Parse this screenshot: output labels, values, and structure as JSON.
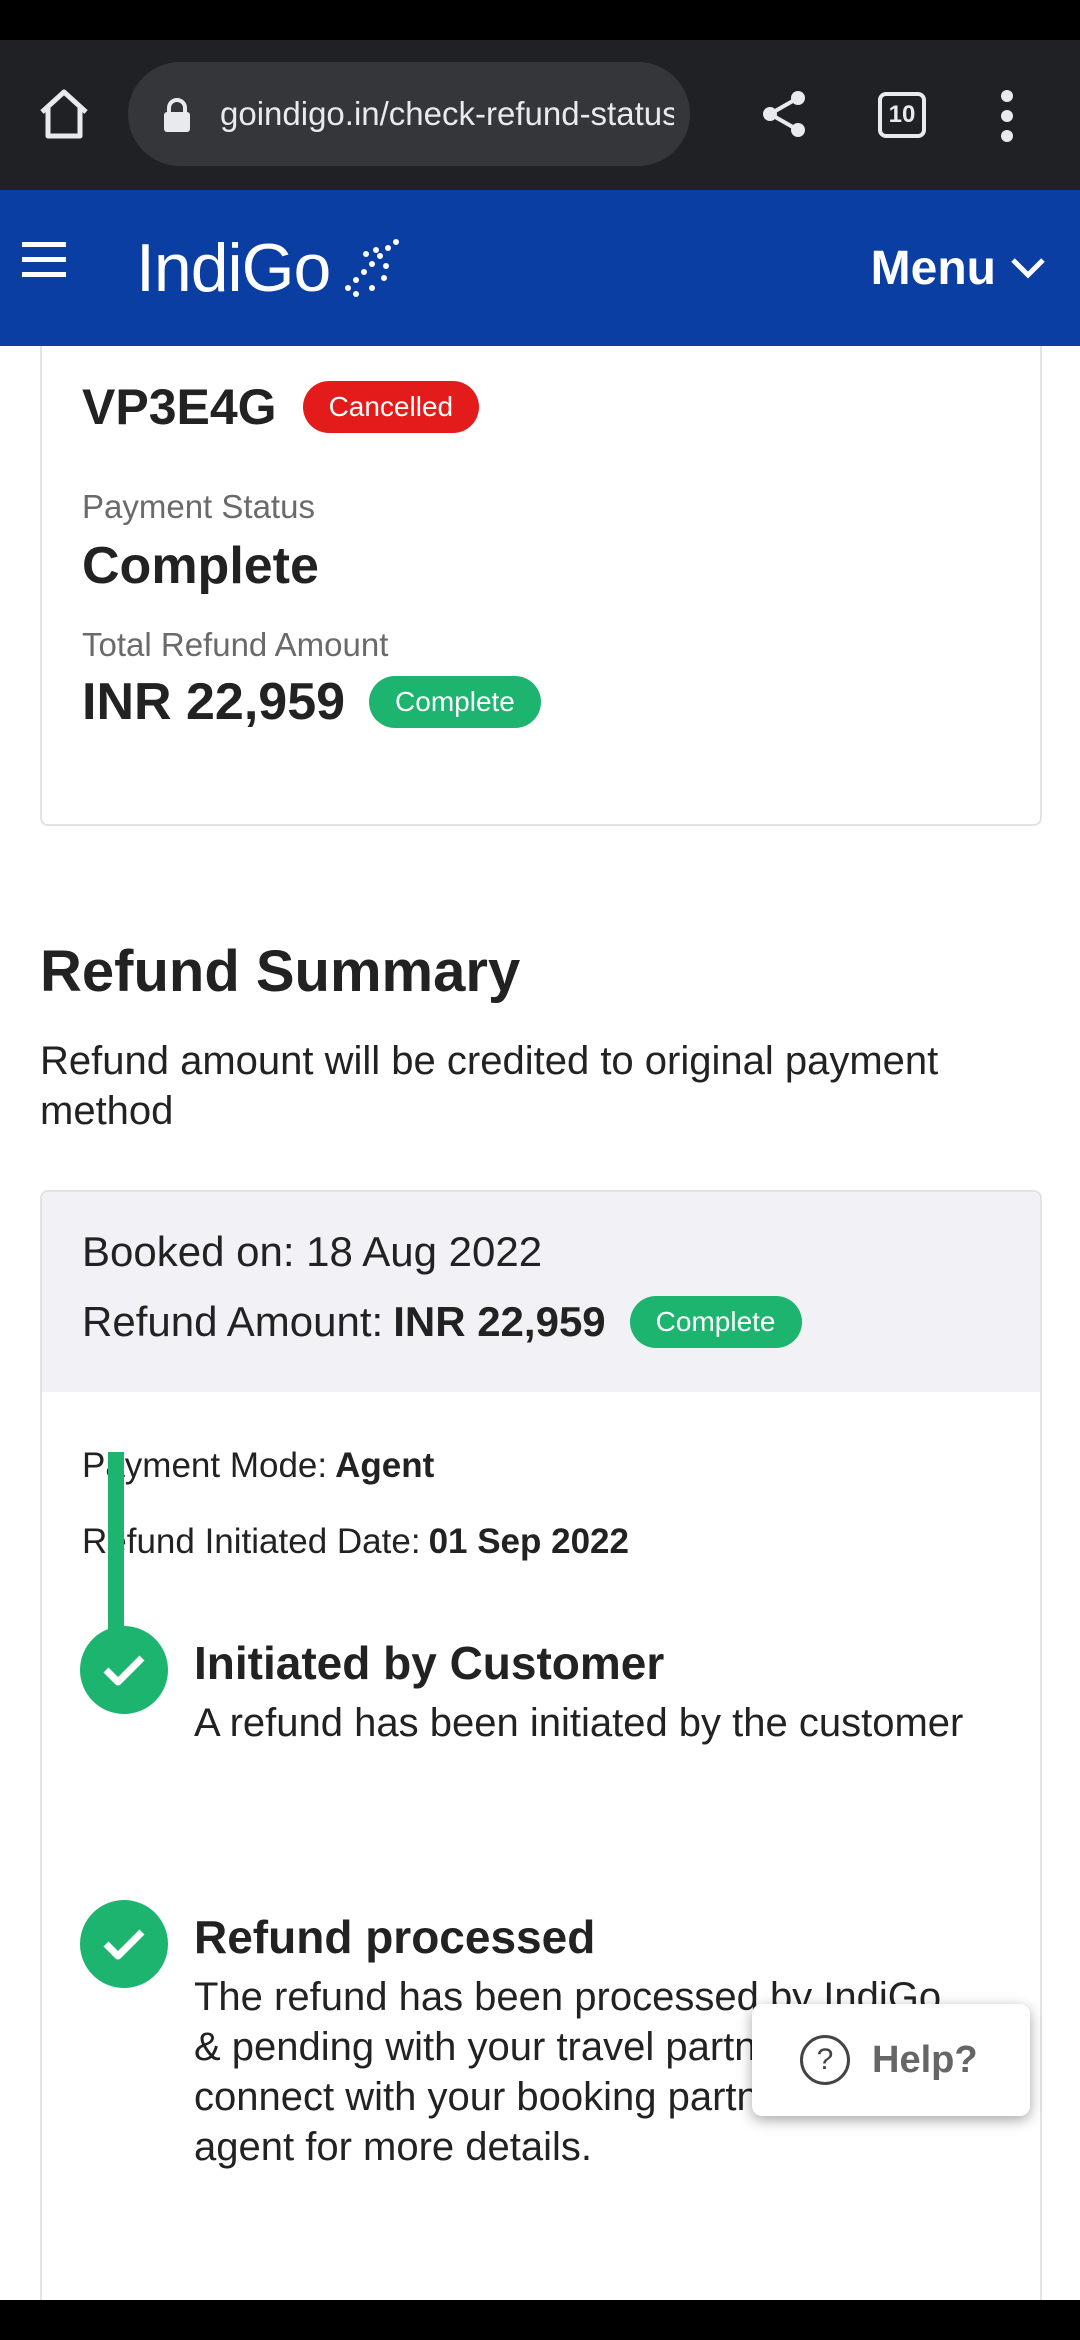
{
  "browser": {
    "url": "goindigo.in/check-refund-status",
    "tab_count": "10"
  },
  "header": {
    "logo_text": "IndiGo",
    "menu_label": "Menu"
  },
  "booking": {
    "pnr": "VP3E4G",
    "pnr_status": "Cancelled",
    "payment_status_label": "Payment Status",
    "payment_status_value": "Complete",
    "total_refund_label": "Total Refund Amount",
    "total_refund_value": "INR 22,959",
    "total_refund_status": "Complete"
  },
  "summary": {
    "title": "Refund Summary",
    "description": "Refund amount will be credited to original payment method",
    "booked_on": "Booked on: 18 Aug 2022",
    "refund_amount_label": "Refund Amount:",
    "refund_amount_value": "INR 22,959",
    "refund_status": "Complete",
    "payment_mode_label": "Payment Mode:",
    "payment_mode_value": "Agent",
    "initiated_date_label": "Refund Initiated Date:",
    "initiated_date_value": "01 Sep 2022"
  },
  "timeline": [
    {
      "title": "Initiated by Customer",
      "description": "A refund has been initiated by the customer"
    },
    {
      "title": "Refund processed",
      "description": "The refund has been processed by IndiGo & pending with your travel partner. Please connect with your booking partner/ travel agent for more details."
    }
  ],
  "help": {
    "label": "Help?"
  },
  "colors": {
    "brand_blue": "#0a3ea3",
    "success_green": "#1db46f",
    "cancel_red": "#e31b1b"
  }
}
